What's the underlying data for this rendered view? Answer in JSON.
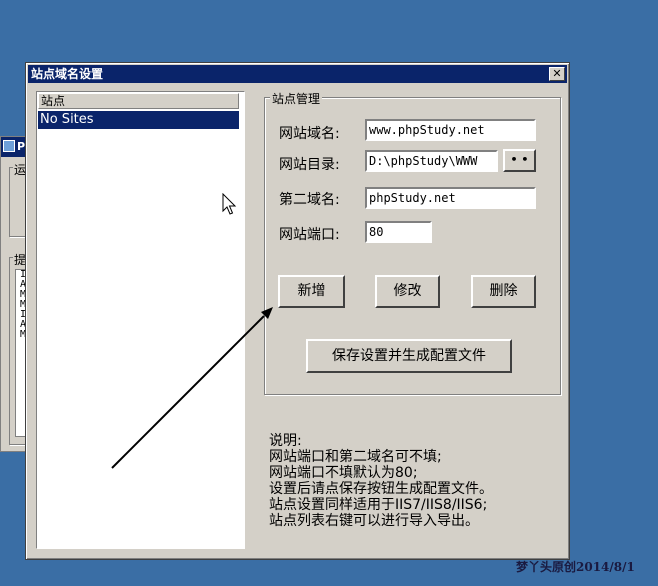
{
  "background_window": {
    "title_fragment": "P",
    "group1_label": "运",
    "group2_label": "提",
    "log_chars": [
      "I",
      "A",
      "M",
      "M",
      "I",
      "A",
      "M"
    ]
  },
  "dialog": {
    "title": "站点域名设置",
    "close_label": "✕",
    "site_list": {
      "header": "站点",
      "items": [
        "No Sites"
      ]
    },
    "group": {
      "label": "站点管理",
      "fields": {
        "domain": {
          "label": "网站域名:",
          "value": "www.phpStudy.net"
        },
        "directory": {
          "label": "网站目录:",
          "value": "D:\\phpStudy\\WWW",
          "browse_label": "• •"
        },
        "second_domain": {
          "label": "第二域名:",
          "value": "phpStudy.net"
        },
        "port": {
          "label": "网站端口:",
          "value": "80"
        }
      },
      "buttons": {
        "add": "新增",
        "edit": "修改",
        "delete": "删除",
        "save": "保存设置并生成配置文件"
      }
    },
    "notes": [
      "说明:",
      "网站端口和第二域名可不填;",
      "网站端口不填默认为80;",
      "设置后请点保存按钮生成配置文件。",
      "站点设置同样适用于IIS7/IIS8/IIS6;",
      "站点列表右键可以进行导入导出。"
    ]
  },
  "watermark": "梦丫头原创2014/8/1",
  "colors": {
    "desktop": "#3a6ea5",
    "titlebar": "#0a246a",
    "face": "#d4d0c8",
    "annotation_arrow": "#000000"
  }
}
